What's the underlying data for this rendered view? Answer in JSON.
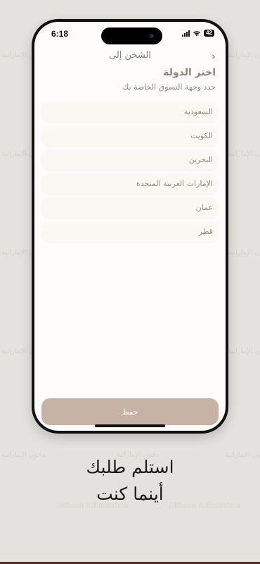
{
  "status_bar": {
    "time": "6:18",
    "battery": "42"
  },
  "header": {
    "title": "الشحن إلى",
    "back_icon": "chevron-right-icon"
  },
  "section": {
    "title": "اختر الدولة",
    "subtitle": "حدد وجهة التسوق الخاصة بك"
  },
  "countries": [
    "السعودية",
    "الكويت",
    "البحرين",
    "الإمارات العربية المتحدة",
    "عمان",
    "قطر"
  ],
  "save_label": "حفظ",
  "tagline": {
    "line1": "استلم طلبك",
    "line2": "أينما كنت"
  },
  "watermark": {
    "arabic": "دخون الإماراتية",
    "latin": "Dkhoon AlEmirateia"
  },
  "colors": {
    "background": "#e3e2de",
    "accent": "#c7b3a5",
    "text_muted": "#958a7f"
  }
}
